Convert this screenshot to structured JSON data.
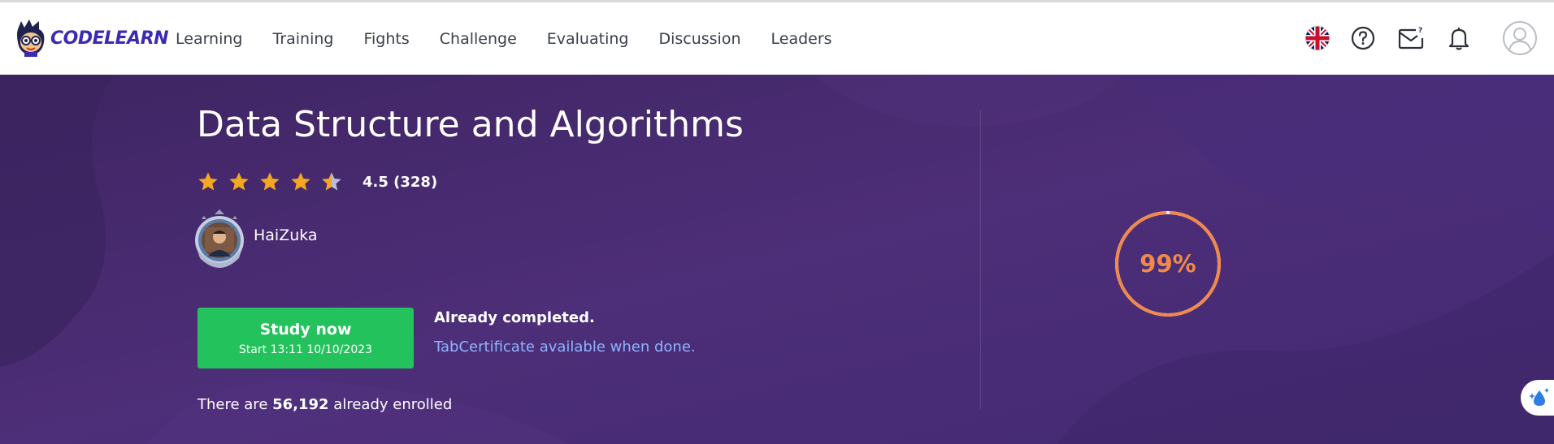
{
  "brand": {
    "logo_text": "CODELEARN"
  },
  "nav": {
    "items": [
      {
        "label": "Learning"
      },
      {
        "label": "Training"
      },
      {
        "label": "Fights"
      },
      {
        "label": "Challenge"
      },
      {
        "label": "Evaluating"
      },
      {
        "label": "Discussion"
      },
      {
        "label": "Leaders"
      }
    ]
  },
  "header_icons": [
    "uk-flag-icon",
    "help-icon",
    "mail-icon",
    "bell-icon",
    "user-avatar-icon"
  ],
  "course": {
    "title": "Data Structure and Algorithms",
    "rating_value": 4.5,
    "rating_text": "4.5 (328)",
    "author": "HaiZuka",
    "study_button": {
      "label": "Study now",
      "sub": "Start 13:11 10/10/2023"
    },
    "completion_status": "Already completed.",
    "certificate_text": "TabCertificate available when done.",
    "enrolled_prefix": "There are ",
    "enrolled_count": "56,192",
    "enrolled_suffix": " already enrolled",
    "progress_percent": 99,
    "progress_text": "99%"
  },
  "colors": {
    "hero_bg": "#4a2b74",
    "accent_green": "#23c25c",
    "progress_orange": "#f0894a",
    "star_gold": "#f5a623",
    "link_blue": "#8fb3ff",
    "brand_indigo": "#3b2bb3"
  }
}
